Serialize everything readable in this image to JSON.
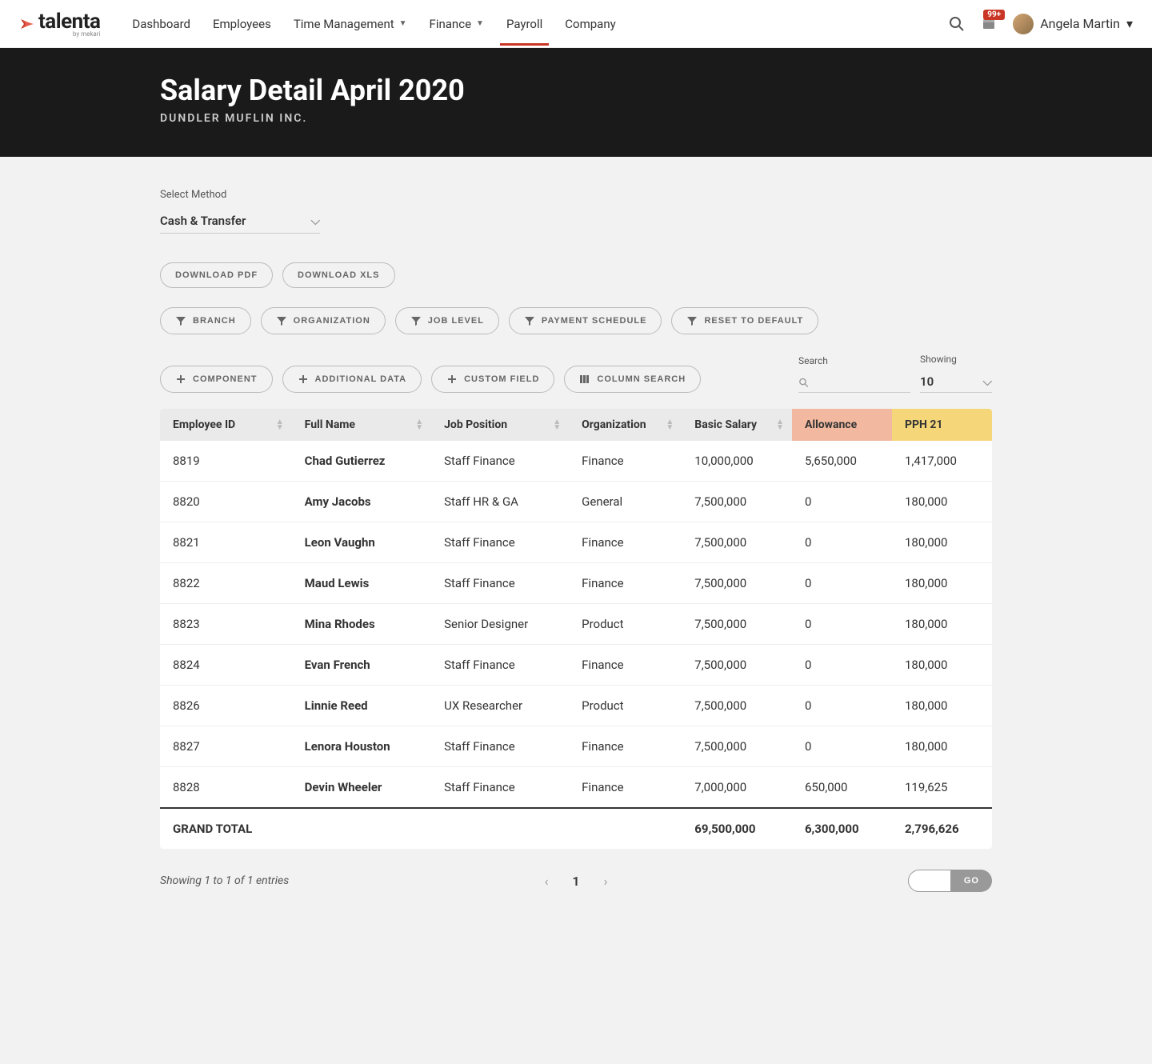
{
  "brand": {
    "name": "talenta",
    "sub": "by mekari"
  },
  "nav": {
    "items": [
      {
        "label": "Dashboard",
        "dropdown": false
      },
      {
        "label": "Employees",
        "dropdown": false
      },
      {
        "label": "Time Management",
        "dropdown": true
      },
      {
        "label": "Finance",
        "dropdown": true
      },
      {
        "label": "Payroll",
        "dropdown": false,
        "active": true
      },
      {
        "label": "Company",
        "dropdown": false
      }
    ],
    "notif_count": "99+",
    "user_name": "Angela Martin"
  },
  "header": {
    "title": "Salary Detail April 2020",
    "company": "DUNDLER MUFLIN INC."
  },
  "method": {
    "label": "Select Method",
    "value": "Cash & Transfer"
  },
  "downloads": {
    "pdf": "DOWNLOAD PDF",
    "xls": "DOWNLOAD XLS"
  },
  "filters": {
    "branch": "BRANCH",
    "organization": "ORGANIZATION",
    "job_level": "JOB LEVEL",
    "payment_schedule": "PAYMENT SCHEDULE",
    "reset": "RESET TO DEFAULT"
  },
  "toggles": {
    "component": "COMPONENT",
    "additional": "ADDITIONAL DATA",
    "custom": "CUSTOM FIELD",
    "column_search": "COLUMN SEARCH"
  },
  "search": {
    "label": "Search",
    "value": ""
  },
  "showing": {
    "label": "Showing",
    "value": "10"
  },
  "table": {
    "headers": {
      "id": "Employee ID",
      "name": "Full Name",
      "pos": "Job Position",
      "org": "Organization",
      "salary": "Basic Salary",
      "allowance": "Allowance",
      "pph": "PPH 21"
    },
    "rows": [
      {
        "id": "8819",
        "name": "Chad Gutierrez",
        "pos": "Staff Finance",
        "org": "Finance",
        "salary": "10,000,000",
        "allowance": "5,650,000",
        "pph": "1,417,000"
      },
      {
        "id": "8820",
        "name": "Amy Jacobs",
        "pos": "Staff HR & GA",
        "org": "General",
        "salary": "7,500,000",
        "allowance": "0",
        "pph": "180,000"
      },
      {
        "id": "8821",
        "name": "Leon Vaughn",
        "pos": "Staff Finance",
        "org": "Finance",
        "salary": "7,500,000",
        "allowance": "0",
        "pph": "180,000"
      },
      {
        "id": "8822",
        "name": "Maud Lewis",
        "pos": "Staff Finance",
        "org": "Finance",
        "salary": "7,500,000",
        "allowance": "0",
        "pph": "180,000"
      },
      {
        "id": "8823",
        "name": "Mina Rhodes",
        "pos": "Senior Designer",
        "org": "Product",
        "salary": "7,500,000",
        "allowance": "0",
        "pph": "180,000"
      },
      {
        "id": "8824",
        "name": "Evan French",
        "pos": "Staff Finance",
        "org": "Finance",
        "salary": "7,500,000",
        "allowance": "0",
        "pph": "180,000"
      },
      {
        "id": "8826",
        "name": "Linnie Reed",
        "pos": "UX Researcher",
        "org": "Product",
        "salary": "7,500,000",
        "allowance": "0",
        "pph": "180,000"
      },
      {
        "id": "8827",
        "name": "Lenora Houston",
        "pos": "Staff Finance",
        "org": "Finance",
        "salary": "7,500,000",
        "allowance": "0",
        "pph": "180,000"
      },
      {
        "id": "8828",
        "name": "Devin Wheeler",
        "pos": "Staff Finance",
        "org": "Finance",
        "salary": "7,000,000",
        "allowance": "650,000",
        "pph": "119,625"
      }
    ],
    "total": {
      "label": "GRAND TOTAL",
      "salary": "69,500,000",
      "allowance": "6,300,000",
      "pph": "2,796,626"
    }
  },
  "pagination": {
    "info": "Showing 1 to 1 of 1 entries",
    "page": "1",
    "go_label": "GO"
  }
}
